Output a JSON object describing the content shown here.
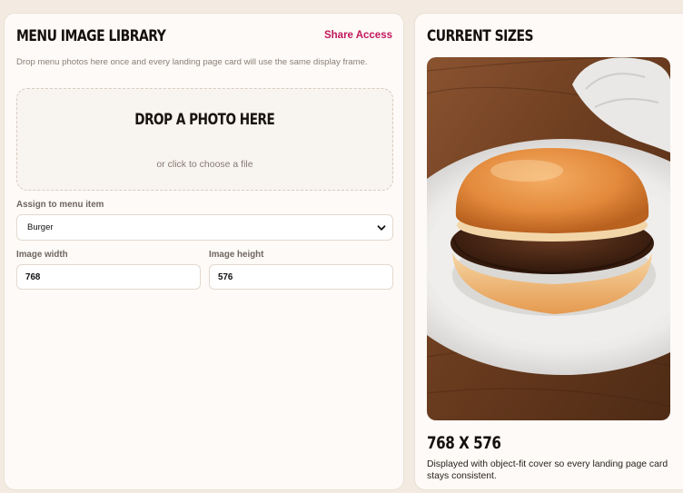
{
  "library": {
    "title": "MENU IMAGE LIBRARY",
    "share_label": "Share Access",
    "description": "Drop menu photos here once and every landing page card will use the same display frame.",
    "dropzone": {
      "title": "DROP A PHOTO HERE",
      "subtitle": "or click to choose a file"
    },
    "assign_label": "Assign to menu item",
    "assign_value": "Burger",
    "width_label": "Image width",
    "width_value": "768",
    "height_label": "Image height",
    "height_value": "576"
  },
  "current_sizes": {
    "title": "CURRENT SIZES",
    "dimensions": "768 X 576",
    "caption": "Displayed with object-fit cover so every landing page card stays consistent."
  },
  "icons": {
    "select_chevron": "chevron-down-icon",
    "preview_photo": "burger-photo"
  },
  "colors": {
    "accent": "#c2185b",
    "page_background": "#f3ebe2",
    "panel_background": "#fdfaf7"
  }
}
